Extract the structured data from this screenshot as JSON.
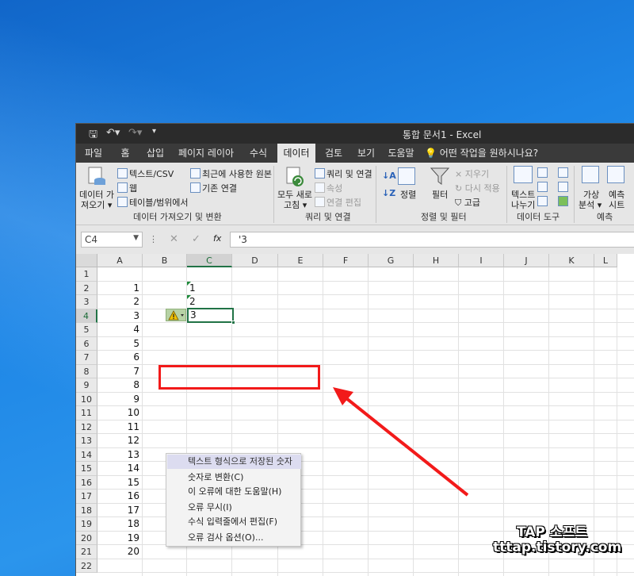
{
  "window": {
    "title": "통합 문서1 - Excel"
  },
  "quick_access": {
    "save_icon": "save-icon",
    "undo_icon": "undo-icon",
    "redo_icon": "redo-icon",
    "more_icon": "customize-icon"
  },
  "tabs": [
    "파일",
    "홈",
    "삽입",
    "페이지 레이아웃",
    "수식",
    "데이터",
    "검토",
    "보기",
    "도움말"
  ],
  "active_tab": "데이터",
  "tell_me": "어떤 작업을 원하시나요?",
  "ribbon": {
    "get_data": {
      "label1": "데이터 가",
      "label2": "져오기 ▾"
    },
    "from_text_csv": "텍스트/CSV",
    "web": "웹",
    "from_table": "테이블/범위에서",
    "recent_sources": "최근에 사용한 원본",
    "existing_connections": "기존 연결",
    "group_get_transform": "데이터 가져오기 및 변환",
    "refresh_all": {
      "label1": "모두 새로",
      "label2": "고침 ▾"
    },
    "queries_connections": "쿼리 및 연결",
    "properties": "속성",
    "edit_links": "연결 편집",
    "group_queries": "쿼리 및 연결",
    "sort": "정렬",
    "filter": "필터",
    "clear": "지우기",
    "reapply": "다시 적용",
    "advanced": "고급",
    "group_sort_filter": "정렬 및 필터",
    "text_to_columns": {
      "label1": "텍스트",
      "label2": "나누기"
    },
    "group_data_tools": "데이터 도구",
    "what_if": {
      "label1": "가상",
      "label2": "분석 ▾"
    },
    "forecast": {
      "label1": "예측",
      "label2": "시트"
    },
    "group_forecast": "예측"
  },
  "formula_bar": {
    "name_box": "C4",
    "fx": "fx",
    "formula": "'3"
  },
  "columns": [
    "A",
    "B",
    "C",
    "D",
    "E",
    "F",
    "G",
    "H",
    "I",
    "J",
    "K",
    "L"
  ],
  "rows": [
    "1",
    "2",
    "3",
    "4",
    "5",
    "6",
    "7",
    "8",
    "9",
    "10",
    "11",
    "12",
    "13",
    "14",
    "15",
    "16",
    "17",
    "18",
    "19",
    "20",
    "21",
    "22"
  ],
  "column_a_values": [
    "1",
    "2",
    "3",
    "4",
    "5",
    "6",
    "7",
    "8",
    "9",
    "10",
    "11",
    "12",
    "13",
    "14",
    "15",
    "16",
    "17",
    "18",
    "19",
    "20"
  ],
  "column_c_values": [
    "1",
    "2",
    "3"
  ],
  "context_menu": {
    "header": "텍스트 형식으로 저장된 숫자",
    "items": [
      "숫자로 변환(C)",
      "이 오류에 대한 도움말(H)",
      "오류 무시(I)",
      "수식 입력줄에서 편집(F)",
      "오류 검사 옵션(O)..."
    ]
  },
  "highlight_color": "#f21a1a",
  "watermark": {
    "line1": "TAP 소프트",
    "line2": "tttap.tistory.com"
  }
}
